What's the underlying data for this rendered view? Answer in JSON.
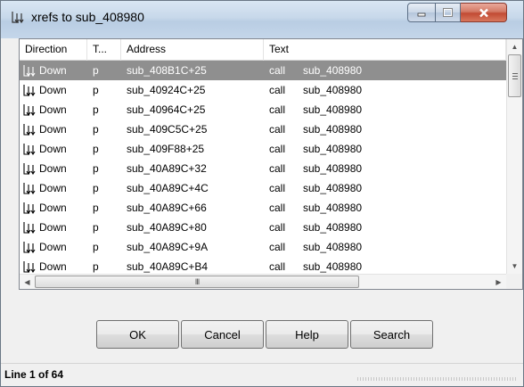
{
  "window": {
    "title": "xrefs to sub_408980"
  },
  "list": {
    "columns": [
      "Direction",
      "T...",
      "Address",
      "Text"
    ],
    "rows": [
      {
        "direction": "Down",
        "type": "p",
        "address": "sub_408B1C+25",
        "instr": "call",
        "operand": "sub_408980"
      },
      {
        "direction": "Down",
        "type": "p",
        "address": "sub_40924C+25",
        "instr": "call",
        "operand": "sub_408980"
      },
      {
        "direction": "Down",
        "type": "p",
        "address": "sub_40964C+25",
        "instr": "call",
        "operand": "sub_408980"
      },
      {
        "direction": "Down",
        "type": "p",
        "address": "sub_409C5C+25",
        "instr": "call",
        "operand": "sub_408980"
      },
      {
        "direction": "Down",
        "type": "p",
        "address": "sub_409F88+25",
        "instr": "call",
        "operand": "sub_408980"
      },
      {
        "direction": "Down",
        "type": "p",
        "address": "sub_40A89C+32",
        "instr": "call",
        "operand": "sub_408980"
      },
      {
        "direction": "Down",
        "type": "p",
        "address": "sub_40A89C+4C",
        "instr": "call",
        "operand": "sub_408980"
      },
      {
        "direction": "Down",
        "type": "p",
        "address": "sub_40A89C+66",
        "instr": "call",
        "operand": "sub_408980"
      },
      {
        "direction": "Down",
        "type": "p",
        "address": "sub_40A89C+80",
        "instr": "call",
        "operand": "sub_408980"
      },
      {
        "direction": "Down",
        "type": "p",
        "address": "sub_40A89C+9A",
        "instr": "call",
        "operand": "sub_408980"
      },
      {
        "direction": "Down",
        "type": "p",
        "address": "sub_40A89C+B4",
        "instr": "call",
        "operand": "sub_408980"
      }
    ],
    "selected_row": 0,
    "hscroll_thumb_label": "III"
  },
  "buttons": {
    "ok": "OK",
    "cancel": "Cancel",
    "help": "Help",
    "search": "Search"
  },
  "status": {
    "text": "Line 1 of 64"
  },
  "icons": {
    "title": "xref-icon",
    "row": "xref-down-icon"
  },
  "colors": {
    "selection": "#8f8f8f",
    "close_button": "#c24a33"
  }
}
